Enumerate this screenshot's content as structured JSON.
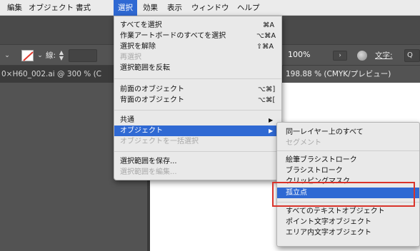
{
  "menubar": {
    "items": [
      {
        "label": "編集"
      },
      {
        "label": "オブジェクト"
      },
      {
        "label": "書式"
      },
      {
        "label": "選択",
        "active": true
      },
      {
        "label": "効果"
      },
      {
        "label": "表示"
      },
      {
        "label": "ウィンドウ"
      },
      {
        "label": "ヘルプ"
      }
    ]
  },
  "controlbar": {
    "stroke_label": "線:",
    "zoom_value": "100%",
    "nav_arrow": "›",
    "character_label": "文字:",
    "search_glyph": "Q"
  },
  "tabs": [
    {
      "label": "0×H60_002.ai @ 300 % (C"
    },
    {
      "label": "198.88 % (CMYK/プレビュー)"
    }
  ],
  "select_menu": {
    "items": [
      {
        "label": "すべてを選択",
        "shortcut": "⌘A"
      },
      {
        "label": "作業アートボードのすべてを選択",
        "shortcut": "⌥⌘A"
      },
      {
        "label": "選択を解除",
        "shortcut": "⇧⌘A"
      },
      {
        "label": "再選択",
        "disabled": true
      },
      {
        "label": "選択範囲を反転"
      },
      {
        "label": "前面のオブジェクト",
        "shortcut": "⌥⌘]"
      },
      {
        "label": "背面のオブジェクト",
        "shortcut": "⌥⌘["
      },
      {
        "label": "共通",
        "submenu": true
      },
      {
        "label": "オブジェクト",
        "submenu": true,
        "highlighted": true
      },
      {
        "label": "オブジェクトを一括選択",
        "disabled": true
      },
      {
        "label": "選択範囲を保存..."
      },
      {
        "label": "選択範囲を編集...",
        "disabled": true
      }
    ]
  },
  "object_submenu": {
    "items": [
      {
        "label": "同一レイヤー上のすべて"
      },
      {
        "label": "セグメント",
        "disabled": true
      },
      {
        "label": "絵筆ブラシストローク"
      },
      {
        "label": "ブラシストローク"
      },
      {
        "label": "クリッピングマスク"
      },
      {
        "label": "孤立点",
        "highlighted": true
      },
      {
        "label": "すべてのテキストオブジェクト"
      },
      {
        "label": "ポイント文字オブジェクト"
      },
      {
        "label": "エリア内文字オブジェクト"
      }
    ]
  },
  "colors": {
    "highlight": "#2f69d3",
    "callout": "#d9342b",
    "menu_bg": "#e9e9e9",
    "app_bg": "#535353"
  }
}
